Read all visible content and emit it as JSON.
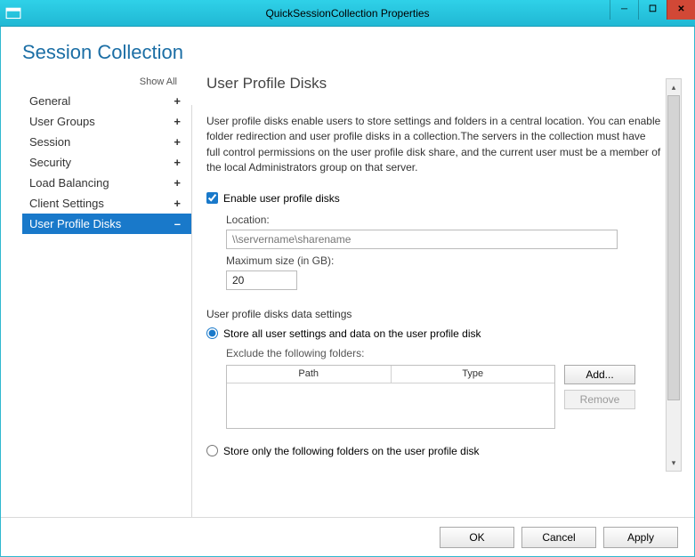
{
  "titlebar": {
    "title": "QuickSessionCollection Properties"
  },
  "header": {
    "title": "Session Collection"
  },
  "sidebar": {
    "show_all": "Show All",
    "items": [
      {
        "label": "General",
        "toggle": "+",
        "active": false
      },
      {
        "label": "User Groups",
        "toggle": "+",
        "active": false
      },
      {
        "label": "Session",
        "toggle": "+",
        "active": false
      },
      {
        "label": "Security",
        "toggle": "+",
        "active": false
      },
      {
        "label": "Load Balancing",
        "toggle": "+",
        "active": false
      },
      {
        "label": "Client Settings",
        "toggle": "+",
        "active": false
      },
      {
        "label": "User Profile Disks",
        "toggle": "–",
        "active": true
      }
    ]
  },
  "main": {
    "heading": "User Profile Disks",
    "description": "User profile disks enable users to store settings and folders in a central location. You can enable folder redirection and user profile disks in a collection.The servers in the collection must have full control permissions on the user profile disk share, and the current user must be a member of the local Administrators group on that server.",
    "enable_label": "Enable user profile disks",
    "enable_checked": true,
    "location_label": "Location:",
    "location_placeholder": "\\\\servername\\sharename",
    "location_value": "",
    "maxsize_label": "Maximum size (in GB):",
    "maxsize_value": "20",
    "data_settings_label": "User profile disks data settings",
    "radio_store_all": "Store all user settings and data on the user profile disk",
    "radio_store_only": "Store only the following folders on the user profile disk",
    "exclude_label": "Exclude the following folders:",
    "table": {
      "col_path": "Path",
      "col_type": "Type"
    },
    "add_btn": "Add...",
    "remove_btn": "Remove"
  },
  "footer": {
    "ok": "OK",
    "cancel": "Cancel",
    "apply": "Apply"
  }
}
